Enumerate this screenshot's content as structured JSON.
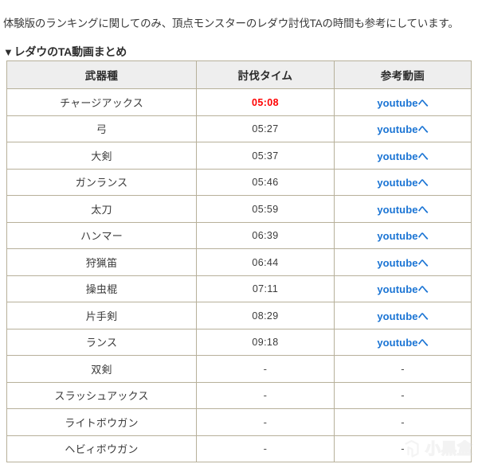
{
  "intro": {
    "text": "体験版のランキングに関してのみ、頂点モンスターのレダウ討伐TAの時間も参考にしています。"
  },
  "section": {
    "marker": "▼",
    "title": "レダウのTA動画まとめ"
  },
  "table": {
    "columns": [
      "武器種",
      "討伐タイム",
      "参考動画"
    ],
    "rows": [
      {
        "weapon": "チャージアックス",
        "time": "05:08",
        "best": true,
        "video": "youtubeへ",
        "has_video": true
      },
      {
        "weapon": "弓",
        "time": "05:27",
        "best": false,
        "video": "youtubeへ",
        "has_video": true
      },
      {
        "weapon": "大剣",
        "time": "05:37",
        "best": false,
        "video": "youtubeへ",
        "has_video": true
      },
      {
        "weapon": "ガンランス",
        "time": "05:46",
        "best": false,
        "video": "youtubeへ",
        "has_video": true
      },
      {
        "weapon": "太刀",
        "time": "05:59",
        "best": false,
        "video": "youtubeへ",
        "has_video": true
      },
      {
        "weapon": "ハンマー",
        "time": "06:39",
        "best": false,
        "video": "youtubeへ",
        "has_video": true
      },
      {
        "weapon": "狩猟笛",
        "time": "06:44",
        "best": false,
        "video": "youtubeへ",
        "has_video": true
      },
      {
        "weapon": "操虫棍",
        "time": "07:11",
        "best": false,
        "video": "youtubeへ",
        "has_video": true
      },
      {
        "weapon": "片手剣",
        "time": "08:29",
        "best": false,
        "video": "youtubeへ",
        "has_video": true
      },
      {
        "weapon": "ランス",
        "time": "09:18",
        "best": false,
        "video": "youtubeへ",
        "has_video": true
      },
      {
        "weapon": "双剣",
        "time": "-",
        "best": false,
        "video": "-",
        "has_video": false
      },
      {
        "weapon": "スラッシュアックス",
        "time": "-",
        "best": false,
        "video": "-",
        "has_video": false
      },
      {
        "weapon": "ライトボウガン",
        "time": "-",
        "best": false,
        "video": "-",
        "has_video": false
      },
      {
        "weapon": "ヘビィボウガン",
        "time": "-",
        "best": false,
        "video": "-",
        "has_video": false
      }
    ]
  },
  "watermark": {
    "text": "小黑盒",
    "icon": "xiaoheihe-logo-icon"
  },
  "colors": {
    "best_time": "#ff0000",
    "link": "#1a74d4",
    "border": "#b7b09a",
    "header_bg": "#eeeeee"
  }
}
